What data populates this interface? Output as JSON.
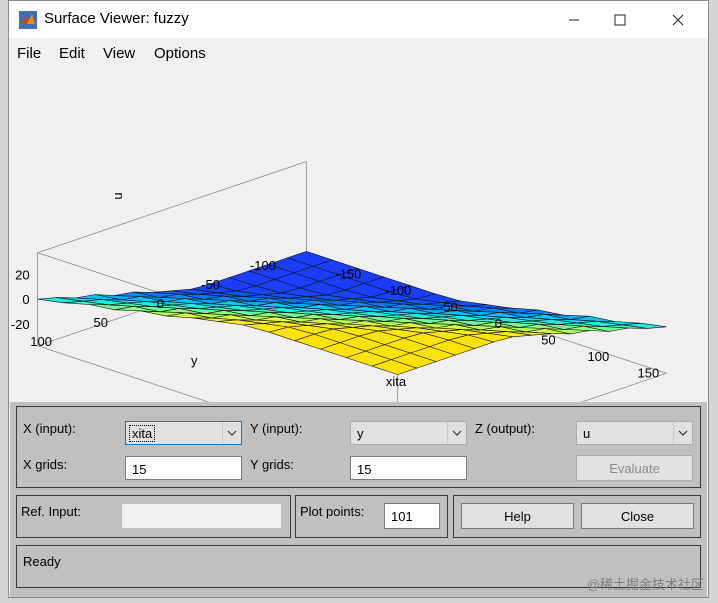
{
  "window": {
    "title": "Surface Viewer: fuzzy"
  },
  "menu": [
    "File",
    "Edit",
    "View",
    "Options"
  ],
  "chart_data": {
    "type": "surface",
    "xlabel": "xita",
    "ylabel": "y",
    "zlabel": "u",
    "x_ticks": [
      "-150",
      "-100",
      "-50",
      "0",
      "50",
      "100",
      "150"
    ],
    "y_ticks": [
      "-100",
      "-50",
      "0",
      "50",
      "100"
    ],
    "z_ticks": [
      "20",
      "0",
      "-20"
    ],
    "grid": false
  },
  "controls": {
    "x_input_label": "X (input):",
    "x_input_value": "xita",
    "y_input_label": "Y (input):",
    "y_input_value": "y",
    "z_output_label": "Z (output):",
    "z_output_value": "u",
    "x_grids_label": "X grids:",
    "x_grids_value": "15",
    "y_grids_label": "Y grids:",
    "y_grids_value": "15",
    "evaluate_label": "Evaluate",
    "ref_input_label": "Ref. Input:",
    "plot_points_label": "Plot points:",
    "plot_points_value": "101",
    "help_label": "Help",
    "close_label": "Close"
  },
  "status": "Ready",
  "watermark": "@稀土掘金技术社区"
}
